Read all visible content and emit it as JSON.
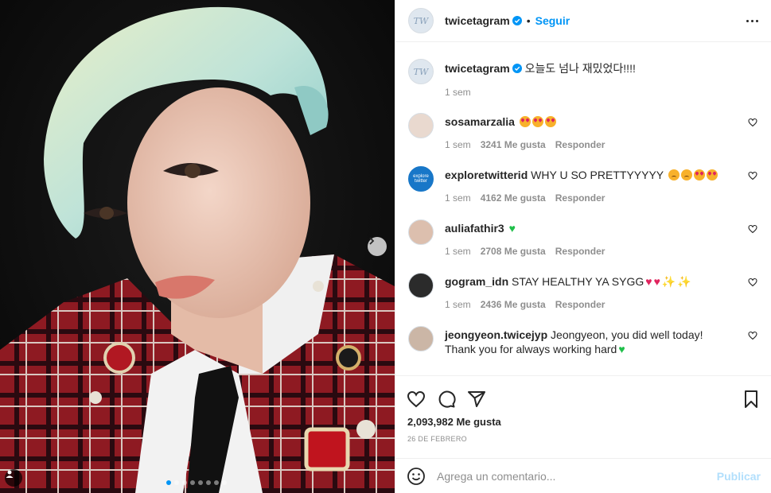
{
  "post": {
    "username": "twicetagram",
    "follow_label": "Seguir",
    "bullet": "•",
    "caption": "오늘도 넘나 재밌었다!!!!",
    "caption_time": "1 sem",
    "likes": "2,093,982 Me gusta",
    "date": "26 DE FEBRERO"
  },
  "comments": [
    {
      "user": "sosamarzalia",
      "text": "",
      "emojis": [
        "love",
        "love",
        "love"
      ],
      "time": "1 sem",
      "likes": "3241 Me gusta",
      "reply": "Responder"
    },
    {
      "user": "exploretwitterid",
      "text": "WHY U SO PRETTYYYYY",
      "emojis": [
        "sad",
        "sad",
        "love",
        "love"
      ],
      "time": "1 sem",
      "likes": "4162 Me gusta",
      "reply": "Responder",
      "avatar_text": "explore twitter"
    },
    {
      "user": "auliafathir3",
      "text": "",
      "emojis": [
        "green-heart"
      ],
      "time": "1 sem",
      "likes": "2708 Me gusta",
      "reply": "Responder"
    },
    {
      "user": "gogram_idn",
      "text": "STAY HEALTHY YA SYGG",
      "emojis": [
        "red-heart",
        "red-heart",
        "sparkles",
        "sparkles"
      ],
      "time": "1 sem",
      "likes": "2436 Me gusta",
      "reply": "Responder"
    },
    {
      "user": "jeongyeon.twicejyp",
      "text": "Jeongyeon, you did well today! Thank you for always working hard",
      "emojis": [
        "green-heart"
      ]
    }
  ],
  "composer": {
    "placeholder": "Agrega un comentario...",
    "publish_label": "Publicar"
  },
  "icons": {
    "like": "heart-icon",
    "comment": "comment-icon",
    "share": "share-icon",
    "save": "bookmark-icon",
    "emoji": "emoji-icon",
    "more": "more-options-icon",
    "next": "chevron-right-icon",
    "tag": "user-tag-icon",
    "verified": "verified-badge-icon"
  },
  "carousel": {
    "slide_count": 8,
    "active_index": 0
  },
  "colors": {
    "accent": "#0095f6",
    "publish_disabled": "#b2dffc",
    "muted": "#8e8e8e"
  }
}
